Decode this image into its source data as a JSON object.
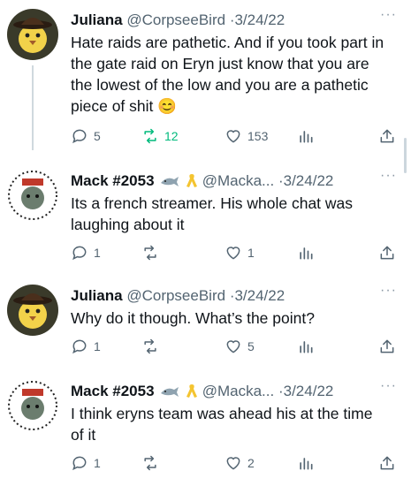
{
  "tweets": [
    {
      "name": "Juliana",
      "handle": "@CorpseeBird",
      "date": "·3/24/22",
      "text": "Hate raids are pathetic. And if you took part in the gate raid on Eryn just know that you are the lowest of the low and you are a pathetic piece of shit 😊",
      "replies": "5",
      "retweets": "12",
      "likes": "153",
      "emojis": []
    },
    {
      "name": "Mack #2053",
      "handle": "@Macka...",
      "date": "·3/24/22",
      "text": "Its a french streamer. His whole chat was laughing about it",
      "replies": "1",
      "retweets": "",
      "likes": "1",
      "emojis": [
        "shark-icon",
        "yellow-ribbon-icon"
      ]
    },
    {
      "name": "Juliana",
      "handle": "@CorpseeBird",
      "date": "·3/24/22",
      "text": "Why do it though. What’s the point?",
      "replies": "1",
      "retweets": "",
      "likes": "5",
      "emojis": []
    },
    {
      "name": "Mack #2053",
      "handle": "@Macka...",
      "date": "·3/24/22",
      "text": "I think eryns team was ahead his at the time of it",
      "replies": "1",
      "retweets": "",
      "likes": "2",
      "emojis": [
        "shark-icon",
        "yellow-ribbon-icon"
      ]
    }
  ],
  "more_label": "···",
  "colors": {
    "retweet_active": "#00ba7c",
    "muted": "#536471",
    "thread_line": "#cfd9de"
  }
}
